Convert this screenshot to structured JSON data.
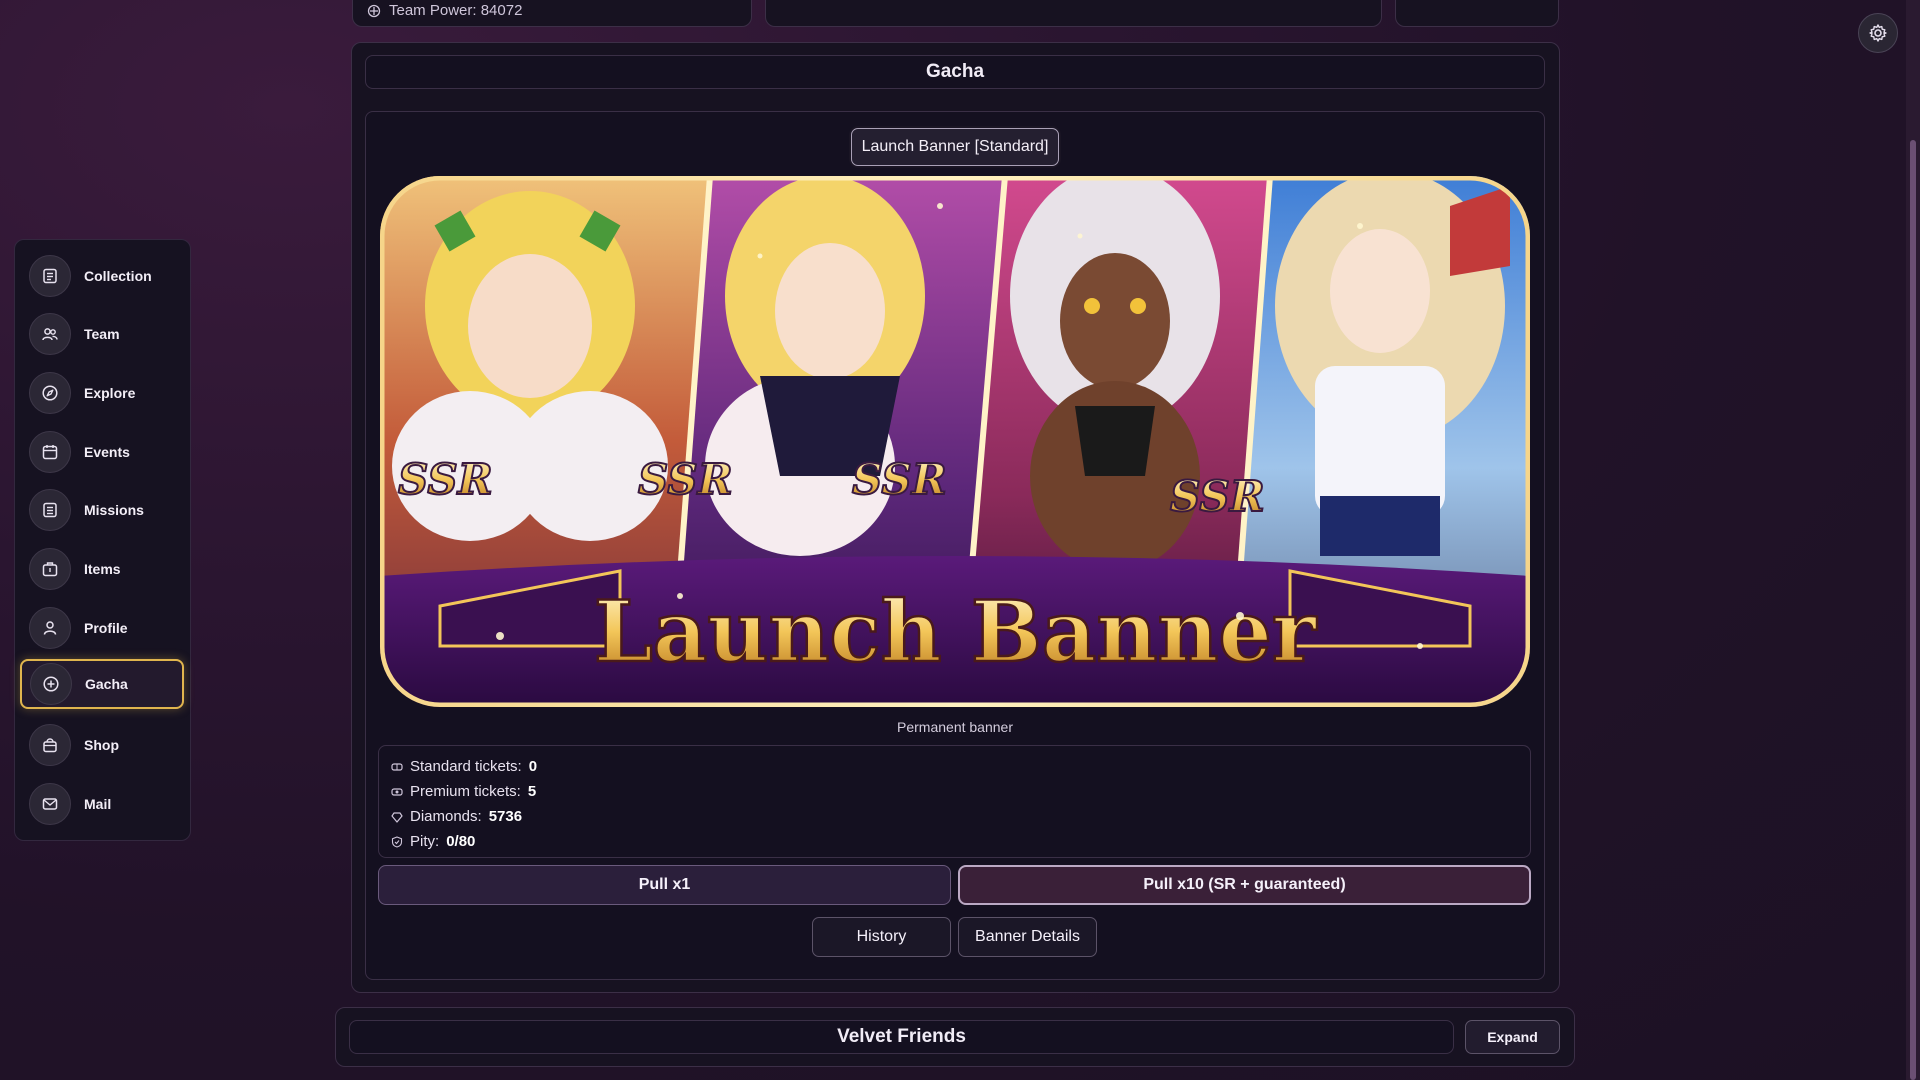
{
  "header": {
    "team_power_label": "Team Power: 84072"
  },
  "sidebar": {
    "items": [
      {
        "label": "Collection",
        "icon": "collection-icon"
      },
      {
        "label": "Team",
        "icon": "team-icon"
      },
      {
        "label": "Explore",
        "icon": "compass-icon"
      },
      {
        "label": "Events",
        "icon": "calendar-icon"
      },
      {
        "label": "Missions",
        "icon": "missions-icon"
      },
      {
        "label": "Items",
        "icon": "items-box-icon"
      },
      {
        "label": "Profile",
        "icon": "user-icon"
      },
      {
        "label": "Gacha",
        "icon": "gacha-plus-icon",
        "active": true
      },
      {
        "label": "Shop",
        "icon": "shop-bag-icon"
      },
      {
        "label": "Mail",
        "icon": "mail-icon"
      }
    ]
  },
  "gacha": {
    "title": "Gacha",
    "banner_select": "Launch Banner [Standard]",
    "banner_image": {
      "title_text": "Launch Banner",
      "rarity_badge": "SSR"
    },
    "banner_caption": "Permanent banner",
    "stats": {
      "standard_tickets_label": "Standard tickets:",
      "standard_tickets_value": "0",
      "premium_tickets_label": "Premium tickets:",
      "premium_tickets_value": "5",
      "diamonds_label": "Diamonds:",
      "diamonds_value": "5736",
      "pity_label": "Pity:",
      "pity_value": "0/80"
    },
    "pull_x1_label": "Pull x1",
    "pull_x10_label": "Pull x10 (SR + guaranteed)",
    "history_label": "History",
    "banner_details_label": "Banner Details"
  },
  "friends": {
    "title": "Velvet Friends",
    "expand_label": "Expand"
  },
  "colors": {
    "accent_gold": "#e0b54e",
    "panel_bg": "#171221",
    "page_bg": "#2a1530"
  }
}
